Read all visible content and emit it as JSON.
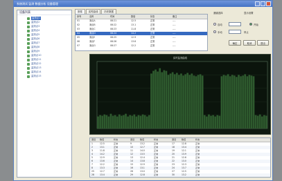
{
  "window": {
    "title": "系统测试 监测 数据分析 设备管理"
  },
  "tree": {
    "header": "设备列表",
    "items": [
      {
        "label": "监测点1",
        "selected": true
      },
      {
        "label": "监测点2",
        "selected": false
      },
      {
        "label": "监测点3",
        "selected": false
      },
      {
        "label": "监测点4",
        "selected": false
      },
      {
        "label": "监测点5",
        "selected": false
      },
      {
        "label": "监测点6",
        "selected": false
      },
      {
        "label": "监测点7",
        "selected": false
      },
      {
        "label": "监测点8",
        "selected": false
      },
      {
        "label": "监测点9",
        "selected": false
      },
      {
        "label": "监测点10",
        "selected": false
      },
      {
        "label": "监测点11",
        "selected": false
      },
      {
        "label": "监测点12",
        "selected": false
      },
      {
        "label": "监测点13",
        "selected": false
      },
      {
        "label": "监测点14",
        "selected": false
      },
      {
        "label": "监测点15",
        "selected": false
      }
    ]
  },
  "list": {
    "tabs": [
      {
        "label": "数据"
      },
      {
        "label": "实时曲线"
      },
      {
        "label": "历史数据"
      }
    ],
    "columns": [
      "序号",
      "名称",
      "时间",
      "数值",
      "状态",
      "备注"
    ],
    "rows": [
      {
        "cells": [
          "01",
          "测点A",
          "08:21",
          "12.5",
          "正常",
          "----"
        ],
        "selected": false
      },
      {
        "cells": [
          "02",
          "测点B",
          "08:22",
          "13.1",
          "正常",
          "----"
        ],
        "selected": false
      },
      {
        "cells": [
          "03",
          "测点C",
          "08:23",
          "11.8",
          "正常",
          "----"
        ],
        "selected": false
      },
      {
        "cells": [
          "04",
          "测点D",
          "08:24",
          "14.2",
          "正常",
          "----"
        ],
        "selected": true
      },
      {
        "cells": [
          "05",
          "测点E",
          "08:25",
          "12.9",
          "正常",
          "----"
        ],
        "selected": false
      },
      {
        "cells": [
          "06",
          "测点F",
          "08:26",
          "13.6",
          "正常",
          "----"
        ],
        "selected": false
      },
      {
        "cells": [
          "07",
          "测点G",
          "08:27",
          "12.2",
          "正常",
          "----"
        ],
        "selected": false
      }
    ]
  },
  "controls": {
    "group1_label": "通道选择",
    "group2_label": "显示设置",
    "start_label": "开始",
    "stop_label": "停止",
    "opt_a": "自动",
    "opt_b": "手动",
    "btn_1": "确定",
    "btn_2": "取消",
    "btn_3": "退出"
  },
  "chart": {
    "title": "实时监测曲线"
  },
  "chart_data": {
    "type": "bar",
    "title": "",
    "bar_color": "#2e5a2e",
    "values": [
      0.18,
      0.2,
      0.19,
      0.21,
      0.2,
      0.18,
      0.22,
      0.19,
      0.2,
      0.18,
      0.21,
      0.19,
      0.2,
      0.22,
      0.18,
      0.2,
      0.19,
      0.21,
      0.18,
      0.2,
      0.19,
      0.21,
      0.2,
      0.18,
      0.2,
      0.82,
      0.86,
      0.88,
      0.85,
      0.9,
      0.84,
      0.87,
      0.86,
      0.8,
      0.82,
      0.84,
      0.81,
      0.83,
      0.8,
      0.82,
      0.79,
      0.81,
      0.83,
      0.8,
      0.82,
      0.79,
      0.78,
      0.8,
      0.81,
      0.79,
      0.2,
      0.18,
      0.21,
      0.19,
      0.2,
      0.18,
      0.2,
      0.19,
      0.78,
      0.8,
      0.79,
      0.81,
      0.78,
      0.8,
      0.79,
      0.77,
      0.8,
      0.78,
      0.79,
      0.81,
      0.78,
      0.8,
      0.79,
      0.78,
      0.2,
      0.19,
      0.21,
      0.18,
      0.2,
      0.19
    ],
    "ylim": [
      0,
      1
    ]
  },
  "table": {
    "columns": [
      "通道",
      "数值",
      "状态",
      "通道",
      "数值",
      "状态",
      "通道",
      "数值",
      "状态"
    ],
    "rows": [
      [
        "1",
        "12.5",
        "正常",
        "9",
        "13.2",
        "正常",
        "17",
        "12.8",
        "正常"
      ],
      [
        "2",
        "13.1",
        "正常",
        "10",
        "12.7",
        "正常",
        "18",
        "13.4",
        "正常"
      ],
      [
        "3",
        "11.8",
        "正常",
        "11",
        "14.0",
        "正常",
        "19",
        "12.1",
        "正常"
      ],
      [
        "4",
        "14.2",
        "正常",
        "12",
        "13.5",
        "正常",
        "20",
        "13.9",
        "正常"
      ],
      [
        "5",
        "12.9",
        "正常",
        "13",
        "12.4",
        "正常",
        "21",
        "12.6",
        "正常"
      ],
      [
        "6",
        "13.6",
        "正常",
        "14",
        "13.8",
        "正常",
        "22",
        "13.0",
        "正常"
      ],
      [
        "7",
        "12.2",
        "正常",
        "15",
        "12.9",
        "正常",
        "23",
        "12.3",
        "正常"
      ],
      [
        "8",
        "13.3",
        "正常",
        "16",
        "13.1",
        "正常",
        "24",
        "13.7",
        "正常"
      ],
      [
        "25",
        "12.7",
        "正常",
        "26",
        "13.0",
        "正常",
        "27",
        "12.5",
        "正常"
      ],
      [
        "28",
        "13.4",
        "正常",
        "29",
        "12.8",
        "正常",
        "30",
        "13.2",
        "正常"
      ]
    ]
  }
}
